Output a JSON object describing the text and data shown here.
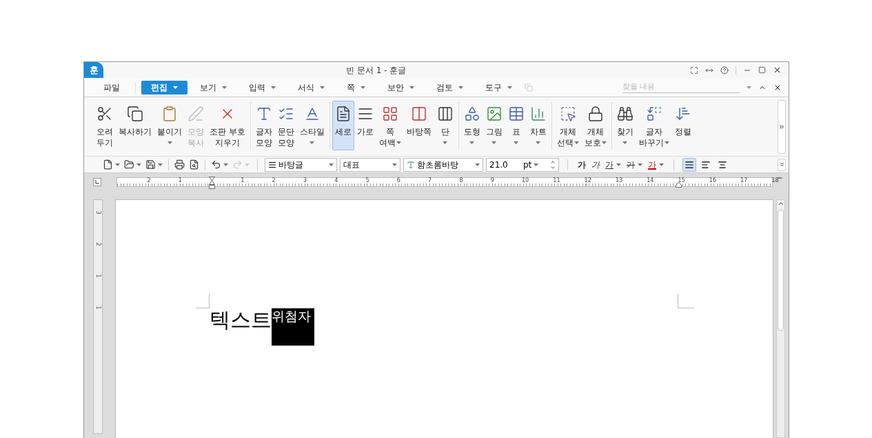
{
  "window": {
    "app_logo": "훈",
    "title": "빈 문서 1 - 훈글"
  },
  "menu": [
    {
      "label": "파일",
      "dropdown": false,
      "selected": false
    },
    {
      "label": "편집",
      "dropdown": true,
      "selected": true
    },
    {
      "label": "보기",
      "dropdown": true,
      "selected": false
    },
    {
      "label": "입력",
      "dropdown": true,
      "selected": false
    },
    {
      "label": "서식",
      "dropdown": true,
      "selected": false
    },
    {
      "label": "쪽",
      "dropdown": true,
      "selected": false
    },
    {
      "label": "보안",
      "dropdown": true,
      "selected": false
    },
    {
      "label": "검토",
      "dropdown": true,
      "selected": false
    },
    {
      "label": "도구",
      "dropdown": true,
      "selected": false
    }
  ],
  "search": {
    "placeholder": "찾을 내용"
  },
  "ribbon": [
    [
      {
        "lines": [
          "오려",
          "두기"
        ],
        "dropdown": false,
        "disabled": false,
        "selected": false
      },
      {
        "lines": [
          "복사하기"
        ],
        "dropdown": false,
        "disabled": false,
        "selected": false
      },
      {
        "lines": [
          "붙이기"
        ],
        "dropdown": true,
        "disabled": false,
        "selected": false
      },
      {
        "lines": [
          "모양",
          "복사"
        ],
        "dropdown": false,
        "disabled": true,
        "selected": false
      },
      {
        "lines": [
          "조판 부호",
          "지우기"
        ],
        "dropdown": false,
        "disabled": false,
        "selected": false
      }
    ],
    [
      {
        "lines": [
          "글자",
          "모양"
        ],
        "dropdown": false,
        "disabled": false,
        "selected": false
      },
      {
        "lines": [
          "문단",
          "모양"
        ],
        "dropdown": false,
        "disabled": false,
        "selected": false
      },
      {
        "lines": [
          "스타일"
        ],
        "dropdown": true,
        "disabled": false,
        "selected": false
      }
    ],
    [
      {
        "lines": [
          "세로"
        ],
        "dropdown": false,
        "disabled": false,
        "selected": true
      },
      {
        "lines": [
          "가로"
        ],
        "dropdown": false,
        "disabled": false,
        "selected": false
      },
      {
        "lines": [
          "쪽",
          "여백"
        ],
        "dropdown": true,
        "disabled": false,
        "selected": false
      },
      {
        "lines": [
          "바탕쪽"
        ],
        "dropdown": false,
        "disabled": false,
        "selected": false
      },
      {
        "lines": [
          "단"
        ],
        "dropdown": true,
        "disabled": false,
        "selected": false
      }
    ],
    [
      {
        "lines": [
          "도형"
        ],
        "dropdown": true,
        "disabled": false,
        "selected": false
      },
      {
        "lines": [
          "그림"
        ],
        "dropdown": true,
        "disabled": false,
        "selected": false
      },
      {
        "lines": [
          "표"
        ],
        "dropdown": true,
        "disabled": false,
        "selected": false
      },
      {
        "lines": [
          "차트"
        ],
        "dropdown": true,
        "disabled": false,
        "selected": false
      }
    ],
    [
      {
        "lines": [
          "개체",
          "선택"
        ],
        "dropdown": true,
        "disabled": false,
        "selected": false
      },
      {
        "lines": [
          "개체",
          "보호"
        ],
        "dropdown": true,
        "disabled": false,
        "selected": false
      }
    ],
    [
      {
        "lines": [
          "찾기"
        ],
        "dropdown": true,
        "disabled": false,
        "selected": false
      },
      {
        "lines": [
          "글자",
          "바꾸기"
        ],
        "dropdown": true,
        "disabled": false,
        "selected": false
      },
      {
        "lines": [
          "정렬"
        ],
        "dropdown": false,
        "disabled": false,
        "selected": false
      }
    ]
  ],
  "quick_tools": [
    {
      "dropdown": true,
      "disabled": false
    },
    {
      "dropdown": true,
      "disabled": false
    },
    {
      "dropdown": true,
      "disabled": false
    },
    {
      "dropdown": false,
      "disabled": false
    },
    {
      "dropdown": false,
      "disabled": false
    },
    {
      "dropdown": true,
      "disabled": false
    },
    {
      "dropdown": true,
      "disabled": true
    }
  ],
  "style_select": "바탕글",
  "language_select": "대표",
  "font_select": "함초롬바탕",
  "font_size": "21.0",
  "size_unit": "pt",
  "format_buttons": [
    {
      "label": "가",
      "kind": "bold",
      "dropdown": false
    },
    {
      "label": "가",
      "kind": "italic",
      "dropdown": false
    },
    {
      "label": "가",
      "kind": "underline",
      "dropdown": true
    },
    {
      "label": "가",
      "kind": "strike",
      "dropdown": true
    },
    {
      "label": "가",
      "kind": "color",
      "dropdown": true
    }
  ],
  "align_buttons": [
    {
      "selected": true
    },
    {
      "selected": false
    },
    {
      "selected": false
    }
  ],
  "ruler": {
    "left_labels": [
      "2",
      "1"
    ],
    "right_labels": [
      "1",
      "2",
      "3",
      "4",
      "5",
      "6",
      "7",
      "8",
      "9",
      "10",
      "11",
      "12",
      "13",
      "14",
      "15",
      "16",
      "17",
      "18"
    ]
  },
  "vertical_ruler": [
    "3",
    "2",
    "1",
    "1"
  ],
  "document": {
    "text": "텍스트",
    "placeholder": "위첨자"
  }
}
